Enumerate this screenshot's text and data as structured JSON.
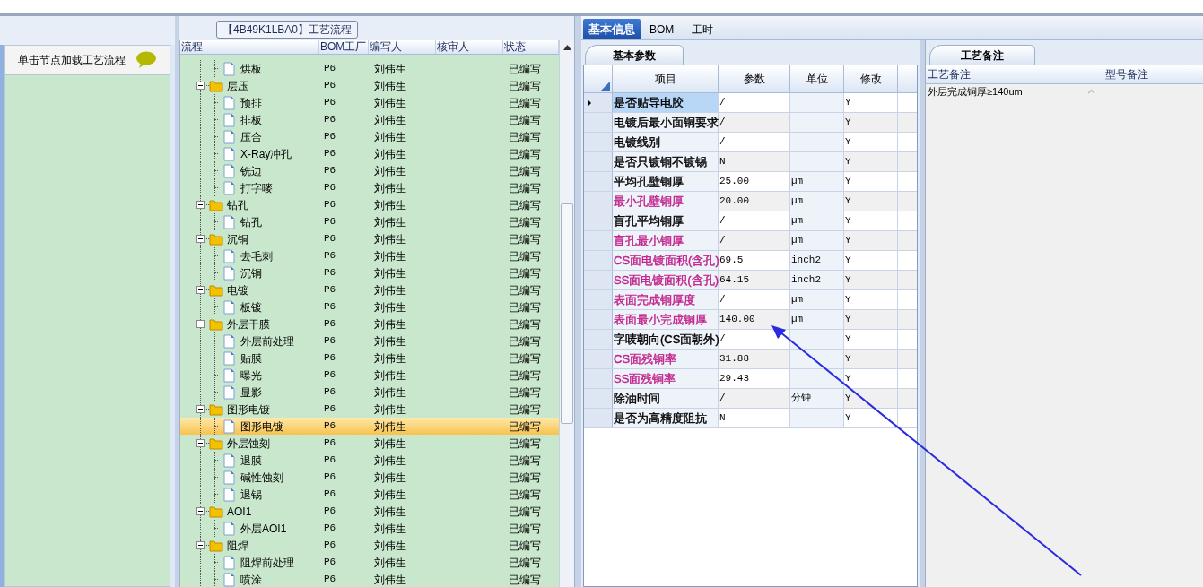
{
  "left_panel": {
    "title": "【4B49K1LBA0】工艺流程",
    "hint": "单击节点加载工艺流程"
  },
  "process_tree": {
    "columns": [
      "流程",
      "BOM工厂",
      "编写人",
      "核审人",
      "状态"
    ],
    "items": [
      {
        "children": [
          {
            "label": "烘板",
            "factory": "P6",
            "writer": "刘伟生",
            "status": "已编写",
            "selected": false
          }
        ]
      },
      {
        "label": "层压",
        "factory": "P6",
        "writer": "刘伟生",
        "status": "已编写",
        "selected": false,
        "children": [
          {
            "label": "预排",
            "factory": "P6",
            "writer": "刘伟生",
            "status": "已编写",
            "selected": false
          },
          {
            "label": "排板",
            "factory": "P6",
            "writer": "刘伟生",
            "status": "已编写",
            "selected": false
          },
          {
            "label": "压合",
            "factory": "P6",
            "writer": "刘伟生",
            "status": "已编写",
            "selected": false
          },
          {
            "label": "X-Ray冲孔",
            "factory": "P6",
            "writer": "刘伟生",
            "status": "已编写",
            "selected": false
          },
          {
            "label": "铣边",
            "factory": "P6",
            "writer": "刘伟生",
            "status": "已编写",
            "selected": false
          },
          {
            "label": "打字嘜",
            "factory": "P6",
            "writer": "刘伟生",
            "status": "已编写",
            "selected": false
          }
        ]
      },
      {
        "label": "钻孔",
        "factory": "P6",
        "writer": "刘伟生",
        "status": "已编写",
        "selected": false,
        "children": [
          {
            "label": "钻孔",
            "factory": "P6",
            "writer": "刘伟生",
            "status": "已编写",
            "selected": false
          }
        ]
      },
      {
        "label": "沉铜",
        "factory": "P6",
        "writer": "刘伟生",
        "status": "已编写",
        "selected": false,
        "children": [
          {
            "label": "去毛刺",
            "factory": "P6",
            "writer": "刘伟生",
            "status": "已编写",
            "selected": false
          },
          {
            "label": "沉铜",
            "factory": "P6",
            "writer": "刘伟生",
            "status": "已编写",
            "selected": false
          }
        ]
      },
      {
        "label": "电镀",
        "factory": "P6",
        "writer": "刘伟生",
        "status": "已编写",
        "selected": false,
        "children": [
          {
            "label": "板镀",
            "factory": "P6",
            "writer": "刘伟生",
            "status": "已编写",
            "selected": false
          }
        ]
      },
      {
        "label": "外层干膜",
        "factory": "P6",
        "writer": "刘伟生",
        "status": "已编写",
        "selected": false,
        "children": [
          {
            "label": "外层前处理",
            "factory": "P6",
            "writer": "刘伟生",
            "status": "已编写",
            "selected": false
          },
          {
            "label": "贴膜",
            "factory": "P6",
            "writer": "刘伟生",
            "status": "已编写",
            "selected": false
          },
          {
            "label": "曝光",
            "factory": "P6",
            "writer": "刘伟生",
            "status": "已编写",
            "selected": false
          },
          {
            "label": "显影",
            "factory": "P6",
            "writer": "刘伟生",
            "status": "已编写",
            "selected": false
          }
        ]
      },
      {
        "label": "图形电镀",
        "factory": "P6",
        "writer": "刘伟生",
        "status": "已编写",
        "selected": false,
        "children": [
          {
            "label": "图形电镀",
            "factory": "P6",
            "writer": "刘伟生",
            "status": "已编写",
            "selected": true
          }
        ]
      },
      {
        "label": "外层蚀刻",
        "factory": "P6",
        "writer": "刘伟生",
        "status": "已编写",
        "selected": false,
        "children": [
          {
            "label": "退膜",
            "factory": "P6",
            "writer": "刘伟生",
            "status": "已编写",
            "selected": false
          },
          {
            "label": "碱性蚀刻",
            "factory": "P6",
            "writer": "刘伟生",
            "status": "已编写",
            "selected": false
          },
          {
            "label": "退锡",
            "factory": "P6",
            "writer": "刘伟生",
            "status": "已编写",
            "selected": false
          }
        ]
      },
      {
        "label": "AOI1",
        "factory": "P6",
        "writer": "刘伟生",
        "status": "已编写",
        "selected": false,
        "children": [
          {
            "label": "外层AOI1",
            "factory": "P6",
            "writer": "刘伟生",
            "status": "已编写",
            "selected": false
          }
        ]
      },
      {
        "label": "阻焊",
        "factory": "P6",
        "writer": "刘伟生",
        "status": "已编写",
        "selected": false,
        "children": [
          {
            "label": "阻焊前处理",
            "factory": "P6",
            "writer": "刘伟生",
            "status": "已编写",
            "selected": false
          },
          {
            "label": "喷涂",
            "factory": "P6",
            "writer": "刘伟生",
            "status": "已编写",
            "selected": false
          }
        ]
      }
    ]
  },
  "tabs": [
    {
      "label": "基本信息",
      "selected": true
    },
    {
      "label": "BOM",
      "selected": false
    },
    {
      "label": "工时",
      "selected": false
    }
  ],
  "params": {
    "tab": "基本参数",
    "columns": [
      "项目",
      "参数",
      "单位",
      "修改"
    ],
    "rows": [
      {
        "item": "是否贴导电胶",
        "color": "#000000",
        "value": "/",
        "unit": "",
        "modify": "Y",
        "selected": true
      },
      {
        "item": "电镀后最小面铜要求",
        "color": "#000000",
        "value": "/",
        "unit": "",
        "modify": "Y",
        "selected": false
      },
      {
        "item": "电镀线别",
        "color": "#000000",
        "value": "/",
        "unit": "",
        "modify": "Y",
        "selected": false
      },
      {
        "item": "是否只镀铜不镀锡",
        "color": "#000000",
        "value": "N",
        "unit": "",
        "modify": "Y",
        "selected": false
      },
      {
        "item": "平均孔壁铜厚",
        "color": "#000000",
        "value": "25.00",
        "unit": "µm",
        "modify": "Y",
        "selected": false
      },
      {
        "item": "最小孔壁铜厚",
        "color": "#c0208a",
        "value": "20.00",
        "unit": "µm",
        "modify": "Y",
        "selected": false
      },
      {
        "item": "盲孔平均铜厚",
        "color": "#000000",
        "value": "/",
        "unit": "µm",
        "modify": "Y",
        "selected": false
      },
      {
        "item": "盲孔最小铜厚",
        "color": "#c0208a",
        "value": "/",
        "unit": "µm",
        "modify": "Y",
        "selected": false
      },
      {
        "item": "CS面电镀面积(含孔)",
        "color": "#c0208a",
        "value": "69.5",
        "unit": "inch2",
        "modify": "Y",
        "selected": false
      },
      {
        "item": "SS面电镀面积(含孔)",
        "color": "#c0208a",
        "value": "64.15",
        "unit": "inch2",
        "modify": "Y",
        "selected": false
      },
      {
        "item": "表面完成铜厚度",
        "color": "#c0208a",
        "value": "/",
        "unit": "µm",
        "modify": "Y",
        "selected": false
      },
      {
        "item": "表面最小完成铜厚",
        "color": "#c0208a",
        "value": "140.00",
        "unit": "µm",
        "modify": "Y",
        "selected": false
      },
      {
        "item": "字唛朝向(CS面朝外)",
        "color": "#000000",
        "value": "/",
        "unit": "",
        "modify": "Y",
        "selected": false
      },
      {
        "item": "CS面残铜率",
        "color": "#c0208a",
        "value": "31.88",
        "unit": "",
        "modify": "Y",
        "selected": false
      },
      {
        "item": "SS面残铜率",
        "color": "#c0208a",
        "value": "29.43",
        "unit": "",
        "modify": "Y",
        "selected": false
      },
      {
        "item": "除油时间",
        "color": "#000000",
        "value": "/",
        "unit": "分钟",
        "modify": "Y",
        "selected": false
      },
      {
        "item": "是否为高精度阻抗",
        "color": "#000000",
        "value": "N",
        "unit": "",
        "modify": "Y",
        "selected": false
      }
    ]
  },
  "remarks": {
    "tab": "工艺备注",
    "columns": [
      "工艺备注",
      "型号备注"
    ],
    "process_note": "外层完成铜厚≥140um"
  }
}
